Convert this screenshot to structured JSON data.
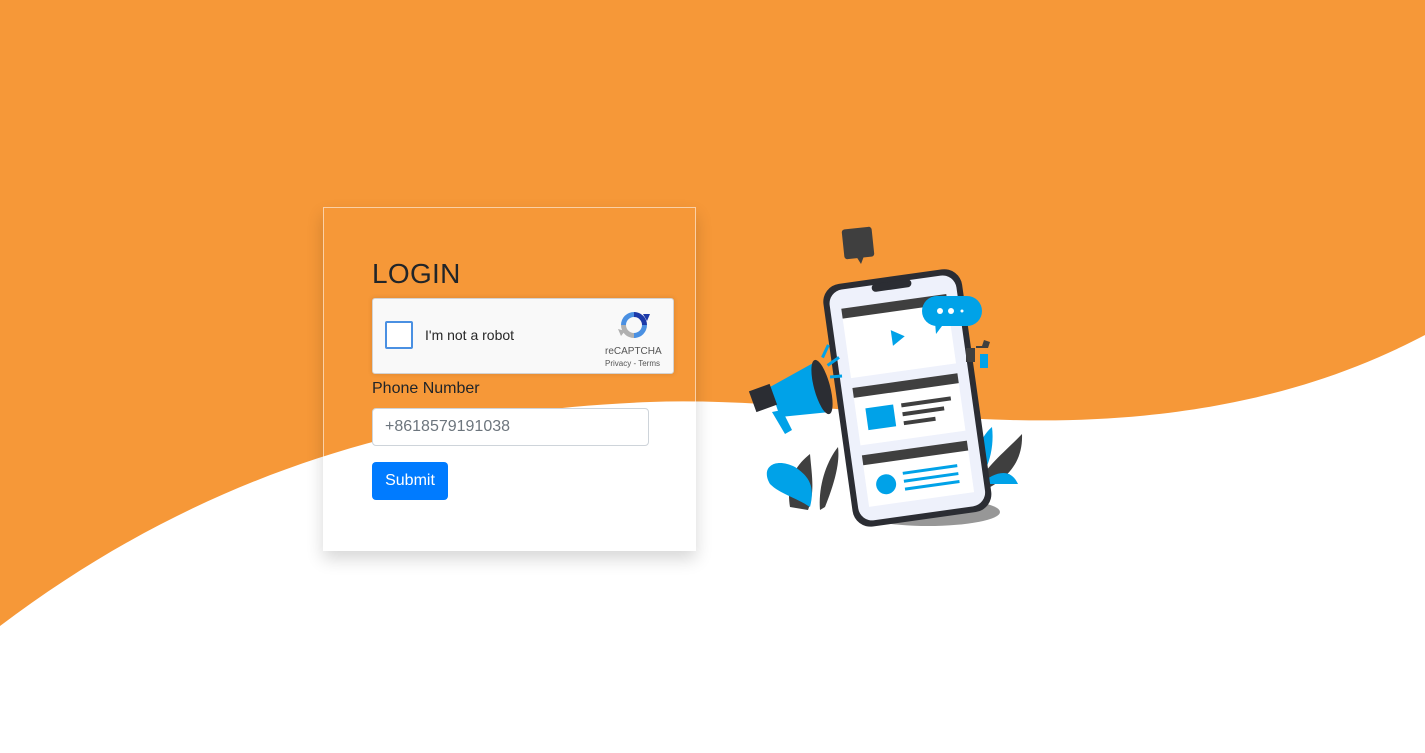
{
  "colors": {
    "background_top": "#f69838",
    "background_bottom": "#ffffff",
    "accent_blue": "#00a2e8",
    "button_blue": "#007bff"
  },
  "login": {
    "title": "LOGIN",
    "captcha": {
      "label": "I'm not a robot",
      "brand": "reCAPTCHA",
      "privacy": "Privacy",
      "separator": " - ",
      "terms": "Terms",
      "icon": "recaptcha-icon"
    },
    "phone": {
      "label": "Phone Number",
      "placeholder": "+8618579191038",
      "value": ""
    },
    "submit_label": "Submit"
  },
  "illustration": {
    "icons": [
      "phone-icon",
      "megaphone-icon",
      "chat-bubble-icon",
      "thumbs-up-icon",
      "play-icon",
      "leaves-icon"
    ]
  }
}
